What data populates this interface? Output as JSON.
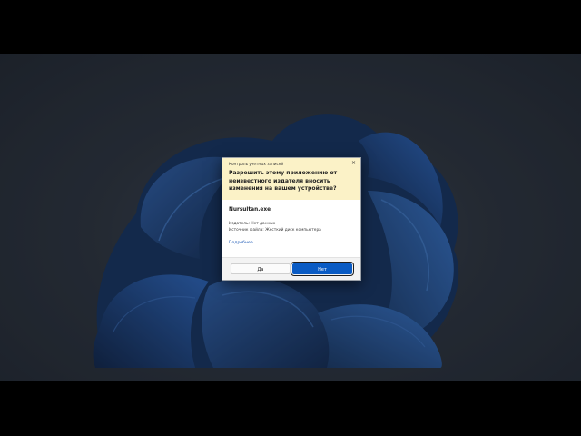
{
  "uac": {
    "caption": "Контроль учетных записей",
    "close_glyph": "×",
    "question": "Разрешить этому приложению от неизвестного издателя вносить изменения на вашем устройстве?",
    "app_name": "Nursultan.exe",
    "publisher": "Издатель: Нет данных",
    "origin": "Источник файла: Жесткий диск компьютера",
    "more_link": "Подробнее",
    "yes_label": "Да",
    "no_label": "Нет"
  },
  "colors": {
    "header_bg": "#fbf2c7",
    "primary_button": "#0a5bc4",
    "link": "#1a57b5",
    "wallpaper_accent": "#1e4a8a"
  }
}
